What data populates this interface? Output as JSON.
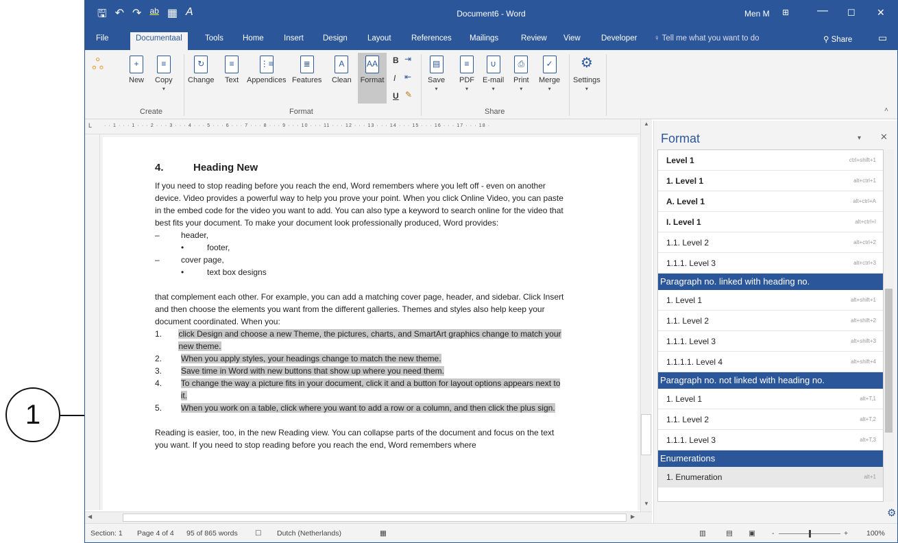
{
  "titlebar": {
    "title": "Document6 - Word",
    "user": "Men M",
    "minimize": "—",
    "maximize": "☐",
    "close": "✕",
    "ribbon_display": "⊞"
  },
  "qat": {
    "save": "🖫",
    "undo": "↶",
    "redo": "↷",
    "spelling": "ab",
    "table": "▦",
    "format": "A"
  },
  "tabs": [
    {
      "label": "File"
    },
    {
      "label": "Documentaal"
    },
    {
      "label": "Tools"
    },
    {
      "label": "Home"
    },
    {
      "label": "Insert"
    },
    {
      "label": "Design"
    },
    {
      "label": "Layout"
    },
    {
      "label": "References"
    },
    {
      "label": "Mailings"
    },
    {
      "label": "Review"
    },
    {
      "label": "View"
    },
    {
      "label": "Developer"
    }
  ],
  "tell_me": "Tell me what you want to do",
  "share": "Share",
  "ribbon": {
    "buttons": {
      "new": "New",
      "copy": "Copy",
      "change": "Change",
      "text": "Text",
      "appendices": "Appendices",
      "features": "Features",
      "clean": "Clean",
      "format": "Format",
      "save": "Save",
      "pdf": "PDF",
      "email": "E-mail",
      "print": "Print",
      "merge": "Merge",
      "settings": "Settings"
    },
    "groups": {
      "create": "Create",
      "format": "Format",
      "share": "Share"
    },
    "small": {
      "bold": "B",
      "italic": "I",
      "underline": "U"
    }
  },
  "ruler_text": "· · 1 · · · 1 · · · 2 · · · 3 · · · 4 · · · 5 · · · 6 · · · 7 · · · 8 · · · 9 · · · 10 · · · 11 · · · 12 · · · 13 · · · 14 · · · 15 · · · 16 · · · 17 · · · 18 ·",
  "document": {
    "heading_num": "4.",
    "heading": "Heading New",
    "para1": "If you need to stop reading before you reach the end, Word remembers where you left off - even on another device. Video provides a powerful way to help you prove your point. When you click Online Video, you can paste in the embed code for the video you want to add. You can also type a keyword to search online for the video that best fits your document. To make your document look professionally produced, Word provides:",
    "bullets": [
      {
        "marker": "–",
        "text": "header,"
      },
      {
        "marker": "•",
        "text": "footer,"
      },
      {
        "marker": "–",
        "text": "cover page,"
      },
      {
        "marker": "•",
        "text": "text box designs"
      }
    ],
    "para2": "that complement each other. For example, you can add a matching cover page, header, and sidebar. Click Insert and then choose the elements you want from the different galleries. Themes and styles also help keep your document coordinated. When you:",
    "numbered": [
      {
        "marker": "1.",
        "text": "click Design and choose a new Theme, the pictures, charts, and SmartArt graphics change to match your new theme."
      },
      {
        "marker": "2.",
        "text": "When you apply styles, your headings change to match the new theme."
      },
      {
        "marker": "3.",
        "text": "Save time in Word with new buttons that show up where you need them."
      },
      {
        "marker": "4.",
        "text": "To change the way a picture fits in your document, click it and a button for layout options appears next to it."
      },
      {
        "marker": "5.",
        "text": "When you work on a table, click where you want to add a row or a column, and then click the plus sign."
      }
    ],
    "para3": "Reading is easier, too, in the new Reading view. You can collapse parts of the document and focus on the text you want. If you need to stop reading before you reach the end, Word remembers where"
  },
  "pane": {
    "title": "Format",
    "dropdown": "▾",
    "close": "✕",
    "rows": [
      {
        "label": "Level 1",
        "shortcut": "ctrl+shift+1",
        "kind": "bold"
      },
      {
        "label": "1. Level 1",
        "shortcut": "alt+ctrl+1",
        "kind": "bold"
      },
      {
        "label": "A. Level 1",
        "shortcut": "alt+ctrl+A",
        "kind": "bold"
      },
      {
        "label": "I. Level 1",
        "shortcut": "alt+ctrl+I",
        "kind": "bold"
      },
      {
        "label": "1.1. Level 2",
        "shortcut": "alt+ctrl+2",
        "kind": "item"
      },
      {
        "label": "1.1.1. Level 3",
        "shortcut": "alt+ctrl+3",
        "kind": "item"
      },
      {
        "label": "Paragraph no. linked with heading no.",
        "shortcut": "",
        "kind": "header"
      },
      {
        "label": "1. Level 1",
        "shortcut": "alt+shift+1",
        "kind": "item"
      },
      {
        "label": "1.1. Level 2",
        "shortcut": "alt+shift+2",
        "kind": "item"
      },
      {
        "label": "1.1.1. Level 3",
        "shortcut": "alt+shift+3",
        "kind": "item"
      },
      {
        "label": "1.1.1.1. Level 4",
        "shortcut": "alt+shift+4",
        "kind": "item"
      },
      {
        "label": "Paragraph no. not linked with heading no.",
        "shortcut": "",
        "kind": "header"
      },
      {
        "label": "1. Level 1",
        "shortcut": "alt+T,1",
        "kind": "item"
      },
      {
        "label": "1.1. Level 2",
        "shortcut": "alt+T,2",
        "kind": "item"
      },
      {
        "label": "1.1.1. Level 3",
        "shortcut": "alt+T,3",
        "kind": "item"
      },
      {
        "label": "Enumerations",
        "shortcut": "",
        "kind": "header"
      },
      {
        "label": "1. Enumeration",
        "shortcut": "alt+1",
        "kind": "sel"
      }
    ]
  },
  "status": {
    "section": "Section: 1",
    "page": "Page 4 of 4",
    "words": "95 of 865 words",
    "language": "Dutch (Netherlands)",
    "zoom": "100%",
    "zoom_minus": "-",
    "zoom_plus": "+"
  },
  "callout": {
    "label": "1"
  },
  "colors": {
    "accent": "#2b579a",
    "highlight": "#c8c8c8"
  }
}
